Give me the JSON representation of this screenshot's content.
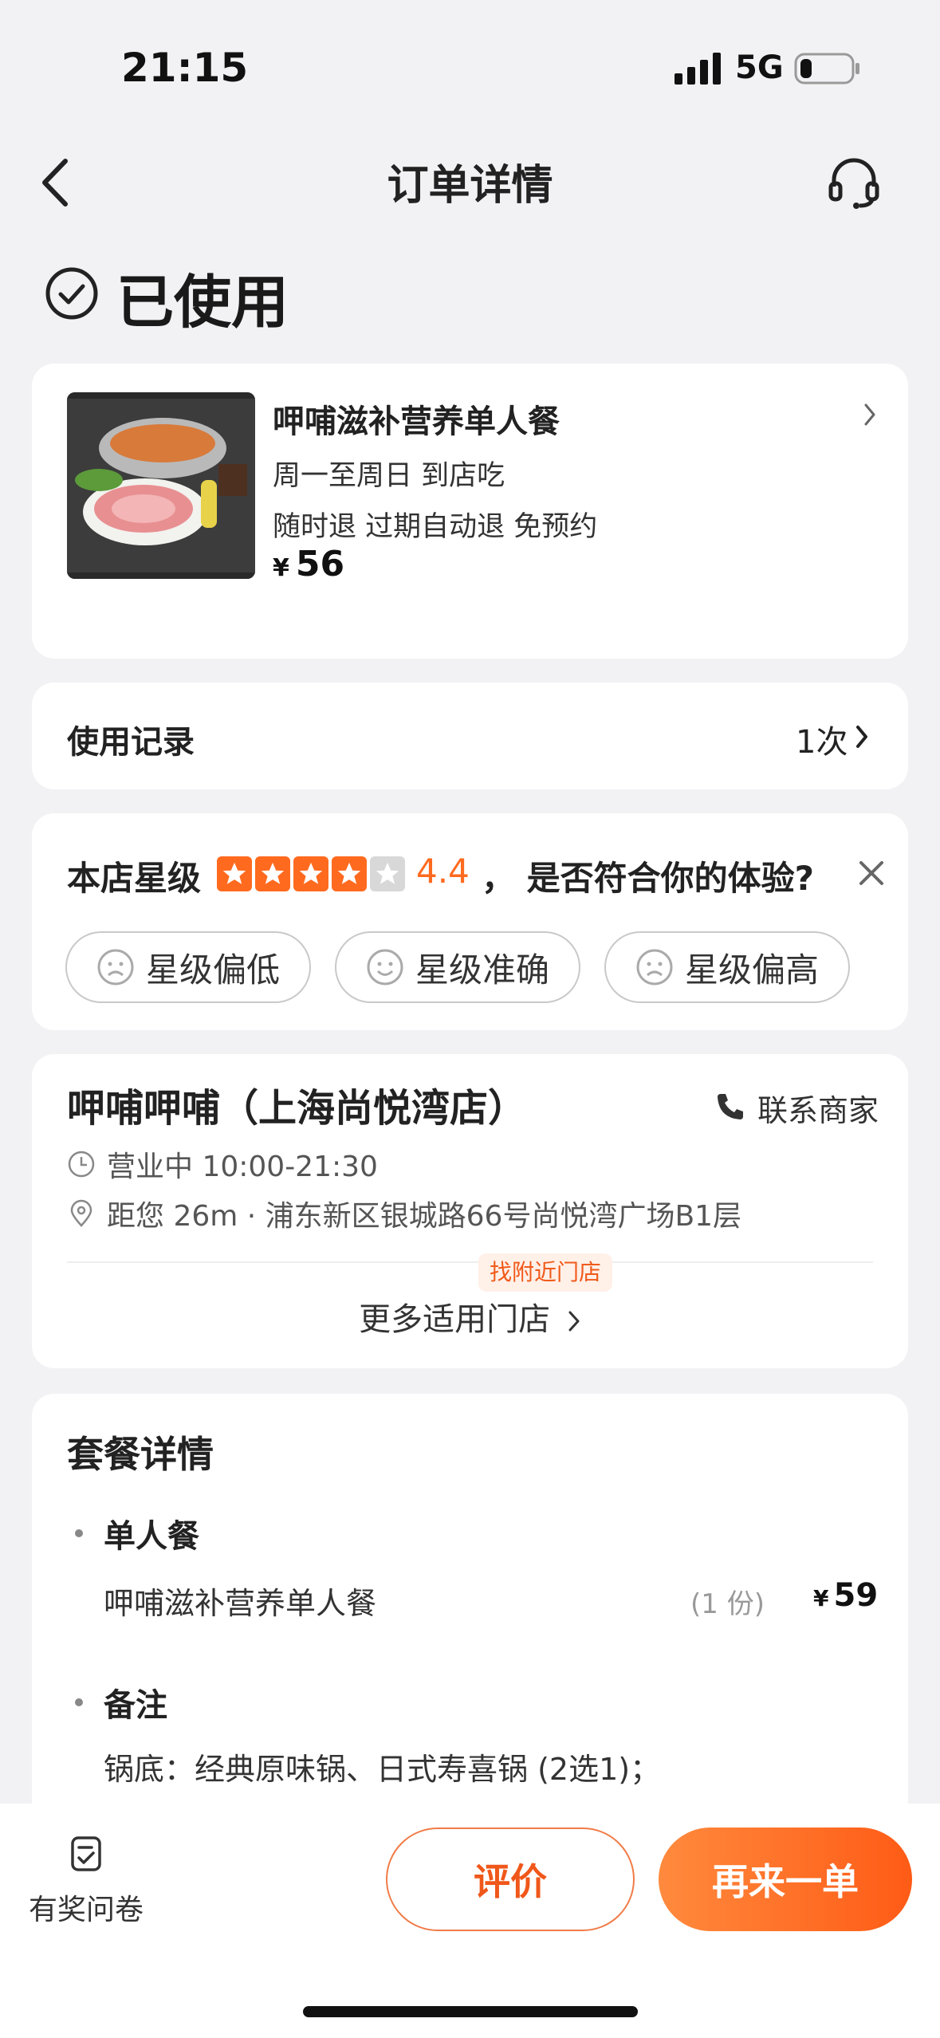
{
  "status_bar": {
    "time": "21:15",
    "network": "5G"
  },
  "nav": {
    "title": "订单详情"
  },
  "order_status": "已使用",
  "product": {
    "name": "呷哺滋补营养单人餐",
    "line1": "周一至周日   到店吃",
    "line2": "随时退   过期自动退   免预约",
    "currency": "¥",
    "price": "56"
  },
  "usage_record": {
    "label": "使用记录",
    "value": "1次"
  },
  "rating": {
    "label": "本店星级",
    "score": "4.4",
    "stars": 4.4,
    "question": "，  是否符合你的体验?",
    "options": [
      "星级偏低",
      "星级准确",
      "星级偏高"
    ],
    "color_active": "#ff6a1f"
  },
  "store": {
    "name": "呷哺呷哺（上海尚悦湾店）",
    "contact_label": "联系商家",
    "hours": "营业中 10:00-21:30",
    "address": "距您 26m · 浦东新区银城路66号尚悦湾广场B1层",
    "nearby_tag": "找附近门店",
    "more_stores": "更多适用门店"
  },
  "package": {
    "title": "套餐详情",
    "section1": "单人餐",
    "item_name": "呷哺滋补营养单人餐",
    "item_qty": "(1 份)",
    "item_currency": "¥",
    "item_price": "59",
    "section2": "备注",
    "note": "锅底：经典原味锅、日式寿喜锅 (2选1)；"
  },
  "bottom": {
    "survey_label": "有奖问卷",
    "review_label": "评价",
    "reorder_label": "再来一单"
  },
  "colors": {
    "accent": "#ff5b16",
    "background": "#f2f2f4"
  }
}
